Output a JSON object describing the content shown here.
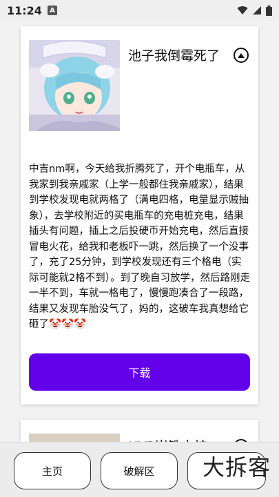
{
  "status_bar": {
    "time": "11:24",
    "notification_letter": "A"
  },
  "feed": {
    "posts": [
      {
        "title": "池子我倒霉死了",
        "body": "中吉nm啊，今天给我折腾死了，开个电瓶车，从我家到我亲戚家（上学一般都住我亲戚家），结果到学校发现电就两格了（满电四格，电量显示贼抽象），去学校附近的买电瓶车的充电桩充电，结果插头有问题，插上之后投硬币开始充电，然后直接冒电火花，给我和老板吓一跳，然后换了一个没事了，充了25分钟，到学校发现还有三个格电（实际可能就2格不到）。到了晚自习放学，然后路刚走一半不到，车就一格电了，慢慢跑凑合了一段路，结果又发现车胎没气了，妈的，这破车我真想给它砸了🤡🤡🤡",
        "download_label": "下载"
      },
      {
        "title": "HVP岩铁中核"
      }
    ]
  },
  "bottom_nav": {
    "home_label": "主页",
    "crack_label": "破解区",
    "third_label": ""
  },
  "watermark": "大拆客",
  "colors": {
    "accent": "#6200ea",
    "background": "#f2f2f2",
    "card": "#ffffff"
  }
}
